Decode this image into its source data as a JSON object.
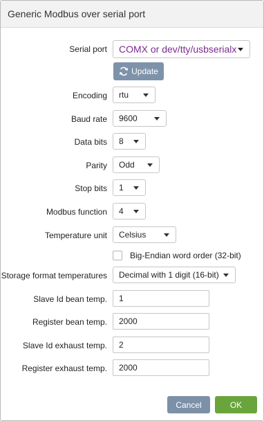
{
  "dialog": {
    "title": "Generic Modbus over serial port"
  },
  "fields": {
    "serial_port": {
      "label": "Serial port",
      "value": "COMX or dev/tty/usbserialx"
    },
    "update_button": "Update",
    "encoding": {
      "label": "Encoding",
      "value": "rtu"
    },
    "baud_rate": {
      "label": "Baud rate",
      "value": "9600"
    },
    "data_bits": {
      "label": "Data bits",
      "value": "8"
    },
    "parity": {
      "label": "Parity",
      "value": "Odd"
    },
    "stop_bits": {
      "label": "Stop bits",
      "value": "1"
    },
    "modbus_function": {
      "label": "Modbus function",
      "value": "4"
    },
    "temperature_unit": {
      "label": "Temperature unit",
      "value": "Celsius"
    },
    "big_endian": {
      "label": "Big-Endian word order (32-bit)",
      "checked": false
    },
    "storage_format": {
      "label": "Storage format temperatures",
      "value": "Decimal with 1 digit (16-bit)"
    },
    "slave_id_bean": {
      "label": "Slave Id bean temp.",
      "value": "1"
    },
    "register_bean": {
      "label": "Register bean temp.",
      "value": "2000"
    },
    "slave_id_exhaust": {
      "label": "Slave Id exhaust temp.",
      "value": "2"
    },
    "register_exhaust": {
      "label": "Register exhaust temp.",
      "value": "2000"
    }
  },
  "footer": {
    "cancel_label": "Cancel",
    "ok_label": "OK"
  },
  "colors": {
    "update_button": "#7e93aa",
    "cancel_button": "#7c91a8",
    "ok_button": "#69a53c",
    "port_text": "#7b2b8f"
  },
  "icons": {
    "update": "refresh-icon"
  }
}
